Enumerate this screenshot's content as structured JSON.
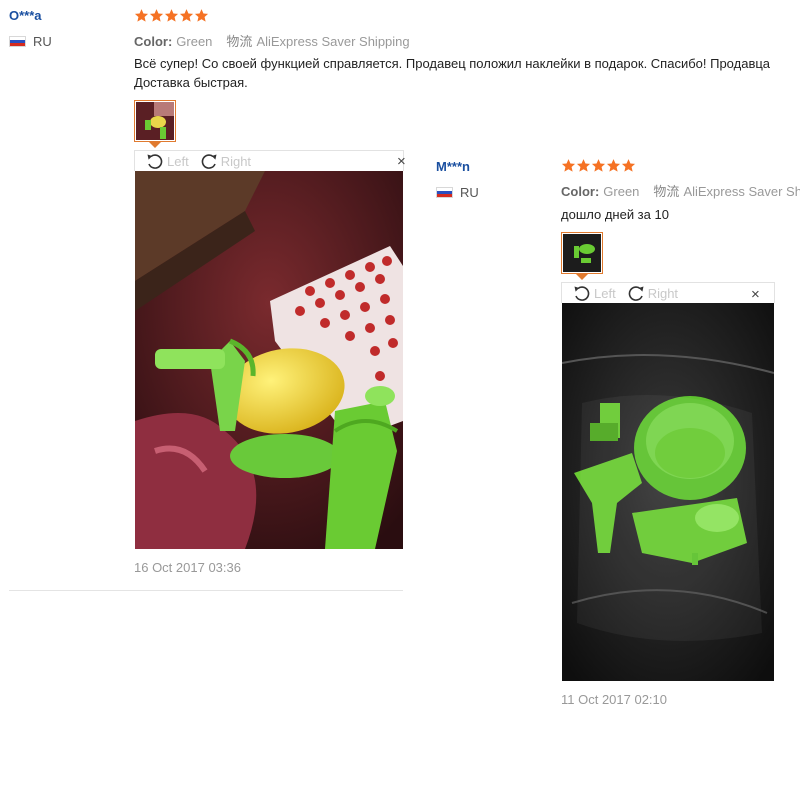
{
  "colors": {
    "star": "#f57224",
    "username": "#1a4fa0",
    "thumb_border": "#e07a2f"
  },
  "reviews": [
    {
      "user": "O***a",
      "country": "RU",
      "rating": 5,
      "color_label": "Color:",
      "color_value": "Green",
      "logistics_label": "物流",
      "logistics_value": "AliExpress Saver Shipping",
      "text_line1": "Всё супер! Со своей функцией справляется. Продавец положил наклейки в подарок. Спасибо! Продавца",
      "text_line2": "Доставка быстрая.",
      "rotate_left": "Left",
      "rotate_right": "Right",
      "close": "×",
      "date": "16 Oct 2017 03:36"
    },
    {
      "user": "M***n",
      "country": "RU",
      "rating": 5,
      "color_label": "Color:",
      "color_value": "Green",
      "logistics_label": "物流",
      "logistics_value": "AliExpress Saver Shipping",
      "text_line1": "дошло дней за 10",
      "rotate_left": "Left",
      "rotate_right": "Right",
      "close": "×",
      "date": "11 Oct 2017 02:10"
    }
  ]
}
